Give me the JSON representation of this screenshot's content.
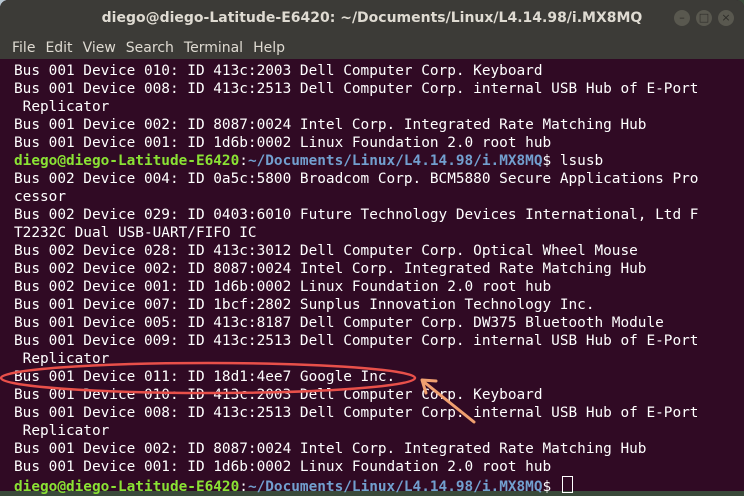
{
  "window": {
    "title": "diego@diego-Latitude-E6420: ~/Documents/Linux/L4.14.98/i.MX8MQ",
    "controls": [
      "–",
      "□",
      "×"
    ]
  },
  "menu": [
    "File",
    "Edit",
    "View",
    "Search",
    "Terminal",
    "Help"
  ],
  "prompt": {
    "user": "diego@diego-Latitude-E6420",
    "sep": ":",
    "path": "~/Documents/Linux/L4.14.98/i.MX8MQ",
    "symbol": "$ "
  },
  "lines": [
    {
      "type": "text",
      "text": "Bus 001 Device 010: ID 413c:2003 Dell Computer Corp. Keyboard"
    },
    {
      "type": "text",
      "text": "Bus 001 Device 008: ID 413c:2513 Dell Computer Corp. internal USB Hub of E-Port"
    },
    {
      "type": "text",
      "text": " Replicator"
    },
    {
      "type": "text",
      "text": "Bus 001 Device 002: ID 8087:0024 Intel Corp. Integrated Rate Matching Hub"
    },
    {
      "type": "text",
      "text": "Bus 001 Device 001: ID 1d6b:0002 Linux Foundation 2.0 root hub"
    },
    {
      "type": "prompt",
      "cmd": "lsusb"
    },
    {
      "type": "text",
      "text": "Bus 002 Device 004: ID 0a5c:5800 Broadcom Corp. BCM5880 Secure Applications Pro"
    },
    {
      "type": "text",
      "text": "cessor"
    },
    {
      "type": "text",
      "text": "Bus 002 Device 029: ID 0403:6010 Future Technology Devices International, Ltd F"
    },
    {
      "type": "text",
      "text": "T2232C Dual USB-UART/FIFO IC"
    },
    {
      "type": "text",
      "text": "Bus 002 Device 028: ID 413c:3012 Dell Computer Corp. Optical Wheel Mouse"
    },
    {
      "type": "text",
      "text": "Bus 002 Device 002: ID 8087:0024 Intel Corp. Integrated Rate Matching Hub"
    },
    {
      "type": "text",
      "text": "Bus 002 Device 001: ID 1d6b:0002 Linux Foundation 2.0 root hub"
    },
    {
      "type": "text",
      "text": "Bus 001 Device 007: ID 1bcf:2802 Sunplus Innovation Technology Inc."
    },
    {
      "type": "text",
      "text": "Bus 001 Device 005: ID 413c:8187 Dell Computer Corp. DW375 Bluetooth Module"
    },
    {
      "type": "text",
      "text": "Bus 001 Device 009: ID 413c:2513 Dell Computer Corp. internal USB Hub of E-Port"
    },
    {
      "type": "text",
      "text": " Replicator"
    },
    {
      "type": "text",
      "text": "Bus 001 Device 011: ID 18d1:4ee7 Google Inc."
    },
    {
      "type": "text",
      "text": "Bus 001 Device 010: ID 413c:2003 Dell Computer Corp. Keyboard"
    },
    {
      "type": "text",
      "text": "Bus 001 Device 008: ID 413c:2513 Dell Computer Corp. internal USB Hub of E-Port"
    },
    {
      "type": "text",
      "text": " Replicator"
    },
    {
      "type": "text",
      "text": "Bus 001 Device 002: ID 8087:0024 Intel Corp. Integrated Rate Matching Hub"
    },
    {
      "type": "text",
      "text": "Bus 001 Device 001: ID 1d6b:0002 Linux Foundation 2.0 root hub"
    },
    {
      "type": "prompt",
      "cmd": "",
      "cursor": true
    }
  ],
  "colors": {
    "background": "#300a24",
    "prompt_user": "#8ae234",
    "prompt_path": "#729fcf",
    "annotation": "#e8504a",
    "arrow": "#f0a070"
  }
}
